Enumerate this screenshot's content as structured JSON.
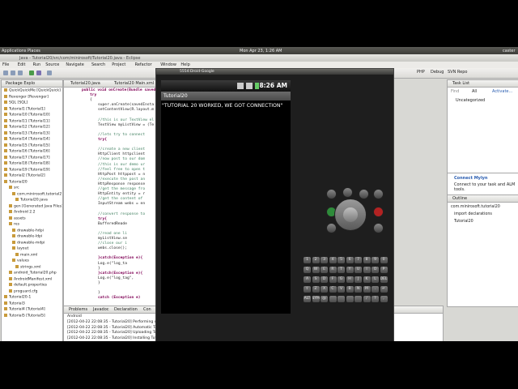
{
  "gnome": {
    "applications": "Applications",
    "places": "Places",
    "clock": "Mon Apr 23, 1:26 AM",
    "user": "caster"
  },
  "window_title": "Java - Tutorial20/src/com/minirosoft/Tutorial20.java - Eclipse",
  "menus": [
    "File",
    "Edit",
    "Run",
    "Source",
    "Navigate",
    "Search",
    "Project",
    "Refactor",
    "Window",
    "Help"
  ],
  "perspectives": [
    "PHP",
    "Debug",
    "SVN Repo"
  ],
  "package_explorer": {
    "tab": "Package Explo",
    "items": [
      "QuickQuickMe [QuickQuick]",
      "Revenger [Revenger]",
      "SQL [SQL]",
      "Tutorial1 [Tutorial1]",
      "Tutorial10 [Tutorial10]",
      "Tutorial11 [Tutorial11]",
      "Tutorial12 [Tutorial12]",
      "Tutorial13 [Tutorial13]",
      "Tutorial14 [Tutorial14]",
      "Tutorial15 [Tutorial15]",
      "Tutorial16 [Tutorial16]",
      "Tutorial17 [Tutorial17]",
      "Tutorial18 [Tutorial18]",
      "Tutorial19 [Tutorial19]",
      "Tutorial2 [Tutorial2]",
      "Tutorial20",
      "src",
      "com.minirosoft.tutorial2",
      "Tutorial20.java",
      "gen [Generated Java Files]",
      "Android 2.2",
      "assets",
      "res",
      "drawable-hdpi",
      "drawable-ldpi",
      "drawable-mdpi",
      "layout",
      "main.xml",
      "values",
      "strings.xml",
      "android_Tutorial20.php",
      "AndroidManifest.xml",
      "default.properties",
      "proguard.cfg",
      "Tutorial20-1",
      "Tutorial3",
      "Tutorial4 [Tutorial4]",
      "Tutorial5 [Tutorial5]"
    ]
  },
  "editor": {
    "tabs": [
      "Tutorial20.java",
      "Tutorial20 Main.xml"
    ],
    "lines": [
      "public void onCreate(Bundle saved",
      "try",
      "{",
      "super.onCreate(savedInsta",
      "setContentView(R.layout.m",
      "",
      "//this is our TextView el",
      "TextView myListView = (Te",
      "",
      "//lets try to connect",
      "try{",
      "",
      "//create a new client",
      "HttpClient httpclient",
      "//now post to our dom",
      "//this is our demo ur",
      "//feel free to open t",
      "HttpPost httppost = n",
      "//execute the post an",
      "HttpResponse response",
      "//get the message fro",
      "HttpEntity entity = r",
      "//get the content of",
      "InputStream webs = en",
      "",
      "//convert response to",
      "try{",
      "BufferedReade",
      "",
      "//read one li",
      "myListView.se",
      "//close our i",
      "webs.close();",
      "",
      "}catch(Exception e){",
      "Log.e(\"log_ta",
      "}",
      "}catch(Exception e){",
      "Log.e(\"log_tag\",",
      "}",
      "",
      "}",
      "catch (Exception e)"
    ]
  },
  "bottom_panel": {
    "tabs": [
      "Problems",
      "Javadoc",
      "Declaration",
      "Con"
    ],
    "console_title": "Android",
    "lines": [
      "[2012-04-22 22:08:35 - Tutorial20] Performing com.minirosoft.tutorial20.Tutorial20 activity launch",
      "[2012-04-22 22:08:35 - Tutorial20] Automatic Target Mode: using existing emulator 'emulator-5554' running compatible AVD 'Droid-Google'",
      "[2012-04-22 22:08:35 - Tutorial20] Uploading Tutorial20.apk onto device 'emulator-5554'",
      "[2012-04-22 22:08:35 - Tutorial20] Installing Tutorial20.apk..."
    ]
  },
  "task_list": {
    "tab": "Task List",
    "find": "Find",
    "all": "All",
    "activate": "Activate...",
    "category": "Uncategorized"
  },
  "mylyn": {
    "title": "Connect Mylyn",
    "text": "Connect to your task and ALM tools."
  },
  "outline": {
    "tab": "Outline",
    "items": [
      "com.minirosoft.tutorial20",
      "import declarations",
      "Tutorial20"
    ]
  },
  "emulator": {
    "window_title": "5554:Droid-Google",
    "time": "8:26 AM",
    "app_title": "Tutorial20",
    "body_text": "\"TUTORIAL 20 WORKED, WE GOT CONNECTION\"",
    "keyboard_rows": [
      [
        "1",
        "2",
        "3",
        "4",
        "5",
        "6",
        "7",
        "8",
        "9",
        "0"
      ],
      [
        "Q",
        "W",
        "E",
        "R",
        "T",
        "Y",
        "U",
        "I",
        "O",
        "P"
      ],
      [
        "A",
        "S",
        "D",
        "F",
        "G",
        "H",
        "J",
        "K",
        "L",
        "DEL"
      ],
      [
        "⇧",
        "Z",
        "X",
        "C",
        "V",
        "B",
        "N",
        "M",
        ".",
        "↵"
      ],
      [
        "ALT",
        "SYM",
        "@",
        "",
        "",
        "",
        "",
        "/",
        "?",
        ","
      ]
    ],
    "colors": {
      "call": "#2e8b3a",
      "end": "#b22222"
    }
  }
}
